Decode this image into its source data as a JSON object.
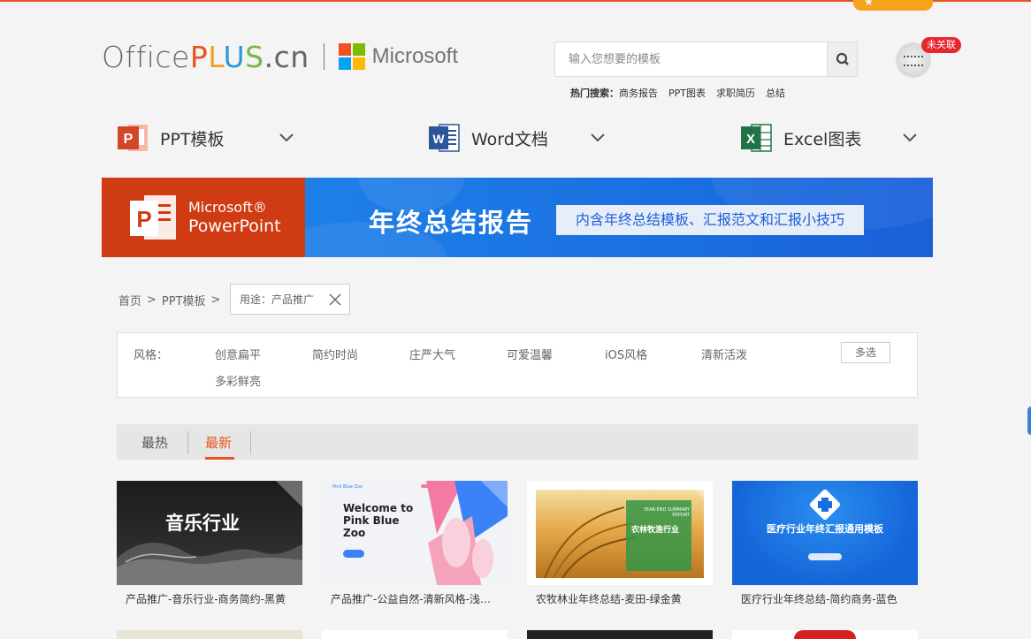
{
  "header": {
    "top_badge": "★",
    "logo": {
      "office": "Office",
      "plus_p": "P",
      "plus_l": "L",
      "plus_u": "U",
      "plus_s": "S",
      "cn": ".cn",
      "partner": "Microsoft"
    },
    "search": {
      "placeholder": "输入您想要的模板"
    },
    "hot_search": {
      "label": "热门搜索：",
      "items": [
        "商务报告",
        "PPT图表",
        "求职简历",
        "总结"
      ]
    },
    "user": {
      "status_badge": "未关联"
    }
  },
  "categories": [
    {
      "label": "PPT模板",
      "icon_letter": "P",
      "color": "#d24726"
    },
    {
      "label": "Word文档",
      "icon_letter": "W",
      "color": "#2b579a"
    },
    {
      "label": "Excel图表",
      "icon_letter": "X",
      "color": "#217346"
    }
  ],
  "banner": {
    "brand_line1": "Microsoft®",
    "brand_line2": "PowerPoint",
    "title": "年终总结报告",
    "subtitle": "内含年终总结模板、汇报范文和汇报小技巧"
  },
  "breadcrumb": {
    "home": "首页",
    "sep": ">",
    "section": "PPT模板",
    "filter": "用途：产品推广"
  },
  "style_filter": {
    "label": "风格：",
    "options": [
      "创意扁平",
      "简约时尚",
      "庄严大气",
      "可爱温馨",
      "iOS风格",
      "清新活泼",
      "多彩鲜亮"
    ],
    "multi_select": "多选"
  },
  "sort_tabs": {
    "hot": "最热",
    "new": "最新"
  },
  "cards": [
    {
      "title": "产品推广-音乐行业-商务简约-黑黄",
      "thumb_text": "音乐行业"
    },
    {
      "title": "产品推广-公益自然-清新风格-浅粉...",
      "thumb_text": "Welcome to Pink Blue Zoo",
      "thumb_brand": "Pink Blue Zoo"
    },
    {
      "title": "农牧林业年终总结-麦田-绿金黄",
      "thumb_text": "农林牧渔行业",
      "thumb_kicker": "YEAR-END SUMMARY REPORT"
    },
    {
      "title": "医疗行业年终总结-简约商务-蓝色",
      "thumb_text": "医疗行业年终汇报通用模板"
    }
  ],
  "colors": {
    "accent": "#e8541e",
    "banner_blue": "#1a6fe0",
    "ppt_red": "#cf3b12"
  }
}
